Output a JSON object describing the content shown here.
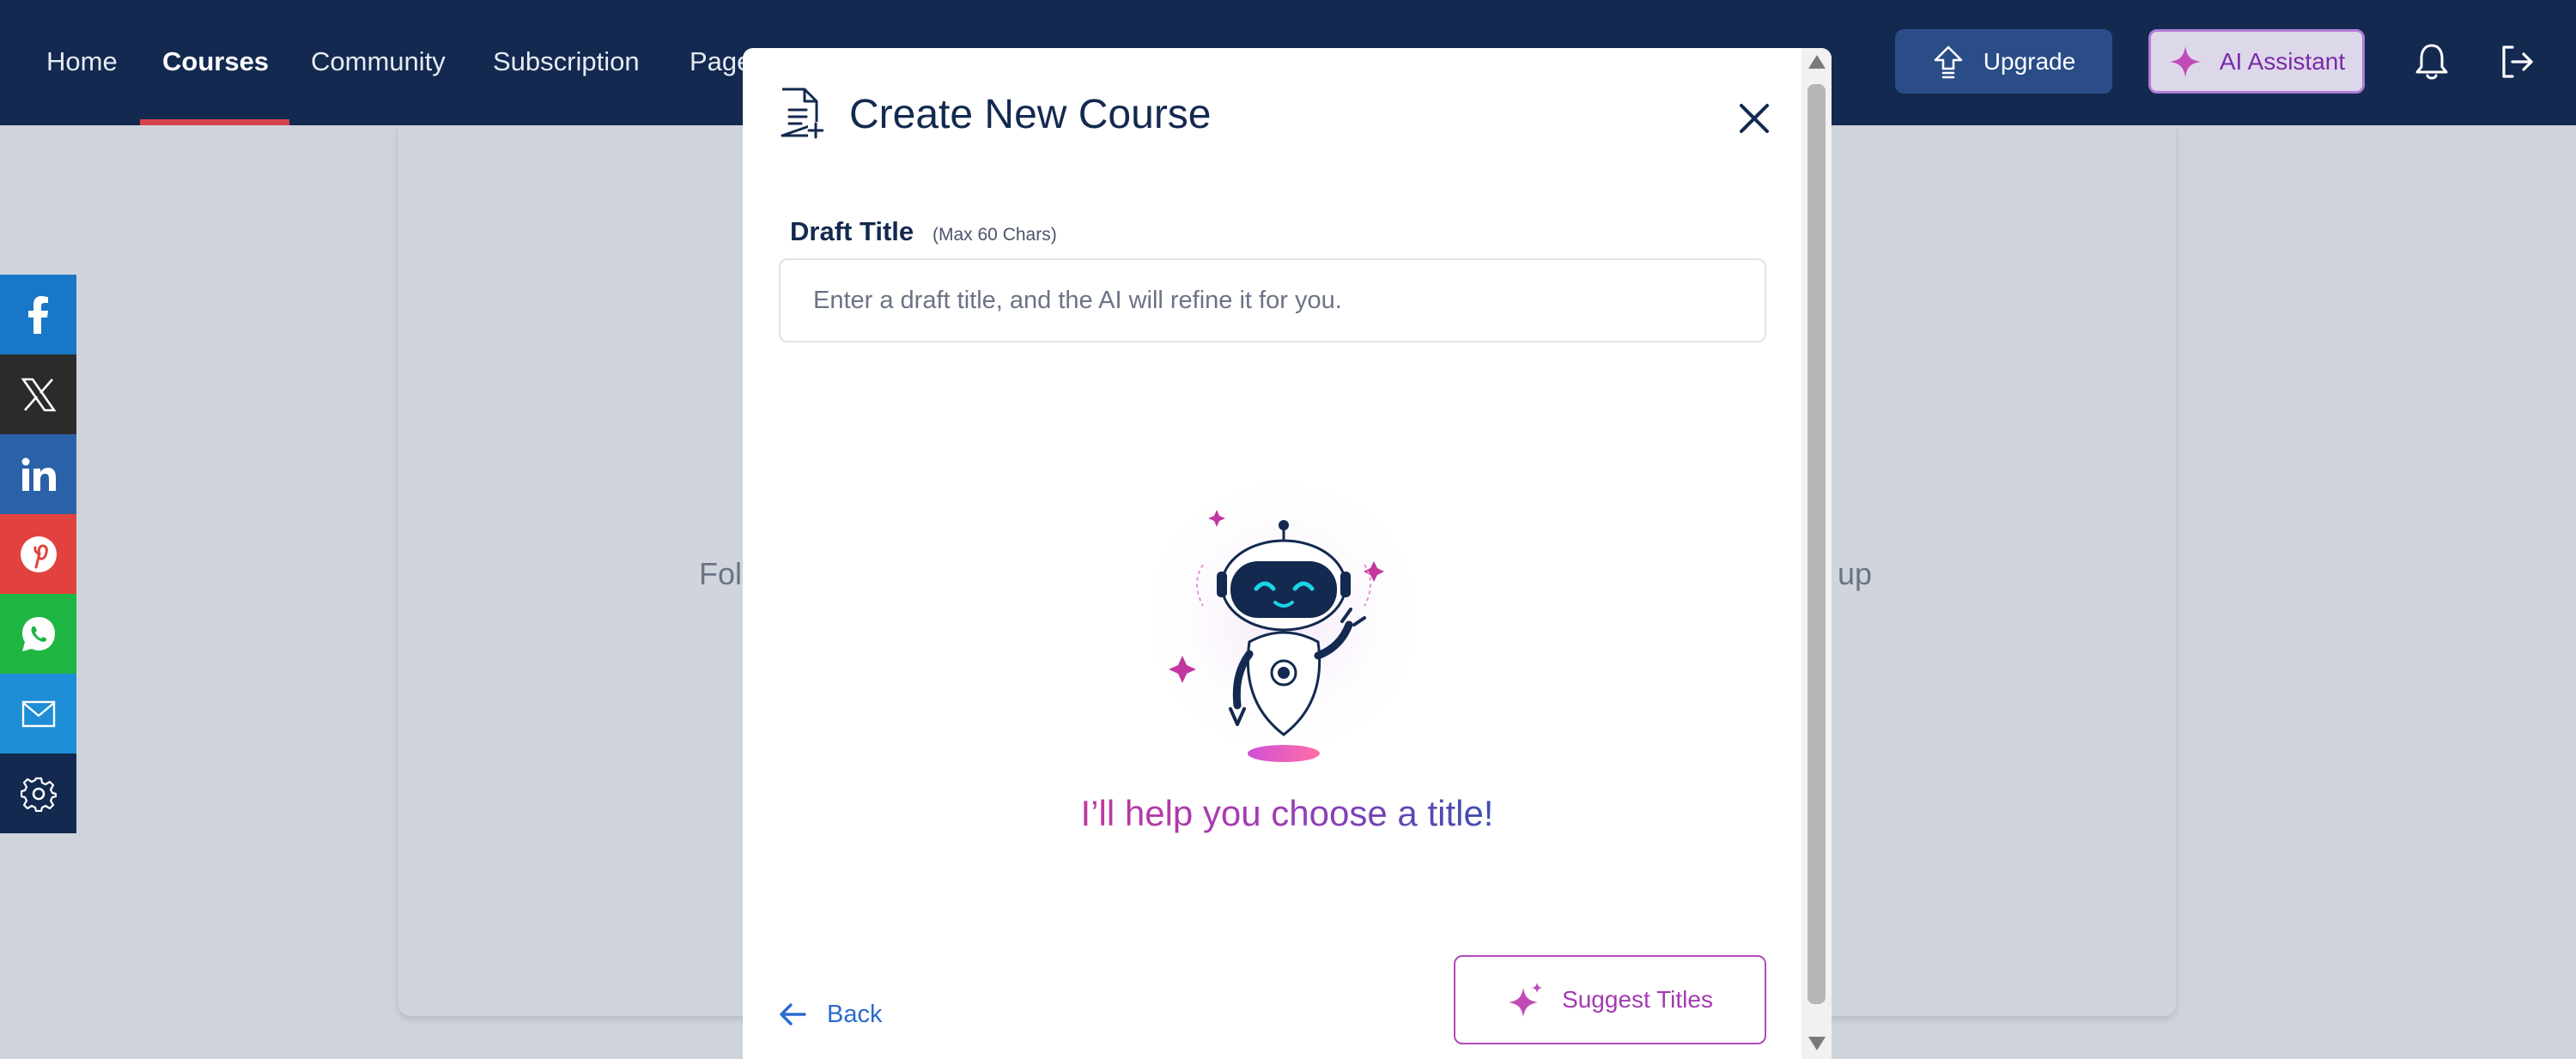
{
  "nav": {
    "links": [
      "Home",
      "Courses",
      "Community",
      "Subscription",
      "Page"
    ],
    "active": "Courses",
    "upgrade_label": "Upgrade",
    "ai_label": "AI Assistant"
  },
  "background": {
    "text_left": "Fol",
    "text_right": "up"
  },
  "social": {
    "items": [
      "facebook-icon",
      "x-icon",
      "linkedin-icon",
      "pinterest-icon",
      "whatsapp-icon",
      "email-icon",
      "settings-icon"
    ],
    "colors": [
      "#1877c6",
      "#2b2b2b",
      "#2b61a8",
      "#e1423f",
      "#1fb543",
      "#1e8ed6",
      "#13294f"
    ]
  },
  "modal": {
    "title": "Create New Course",
    "field_label": "Draft Title",
    "field_hint": "(Max 60 Chars)",
    "input_placeholder": "Enter a draft title, and the AI will refine it for you.",
    "input_value": "",
    "helper_text": "I’ll help you choose a title!",
    "back_label": "Back",
    "suggest_label": "Suggest Titles"
  },
  "colors": {
    "navbar": "#13294f",
    "accent_underline": "#d9434f",
    "ai_purple": "#a23cb0",
    "helper_gradient_start": "#c2379e",
    "helper_gradient_end": "#3a4fb0"
  }
}
